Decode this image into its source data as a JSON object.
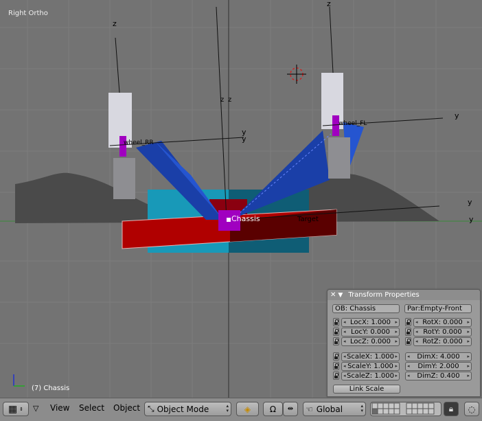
{
  "viewport": {
    "view_label": "Right Ortho",
    "object_label": "(7) Chassis",
    "scene_labels": {
      "z1": "z",
      "z2": "z",
      "z3": "z",
      "z4": "z",
      "y1": "y",
      "y2": "y",
      "y3": "y",
      "y4": "y",
      "y5": "y",
      "chassis": "Chassis",
      "target": "Target",
      "wheel_left": "wheel_RR",
      "wheel_right": "wheel_FL"
    },
    "colors": {
      "background": "#737373",
      "chassis_red": "#b00000",
      "cyan": "#1899b8",
      "blue": "#1a3fa8",
      "magenta": "#a000c0",
      "terrain": "#4a4a4a"
    }
  },
  "transform_panel": {
    "title": "Transform Properties",
    "ob_field": "OB: Chassis",
    "par_field": "Par:Empty-Front",
    "loc": [
      "LocX: 1.000",
      "LocY: 0.000",
      "LocZ: 0.000"
    ],
    "rot": [
      "RotX: 0.000",
      "RotY: 0.000",
      "RotZ: 0.000"
    ],
    "scale": [
      "ScaleX: 1.000",
      "ScaleY: 1.000",
      "ScaleZ: 1.000"
    ],
    "dim": [
      "DimX: 4.000",
      "DimY: 2.000",
      "DimZ: 0.400"
    ],
    "link_scale": "Link Scale"
  },
  "header": {
    "menus": [
      "View",
      "Select",
      "Object"
    ],
    "mode": "Object Mode",
    "orientation": "Global"
  }
}
